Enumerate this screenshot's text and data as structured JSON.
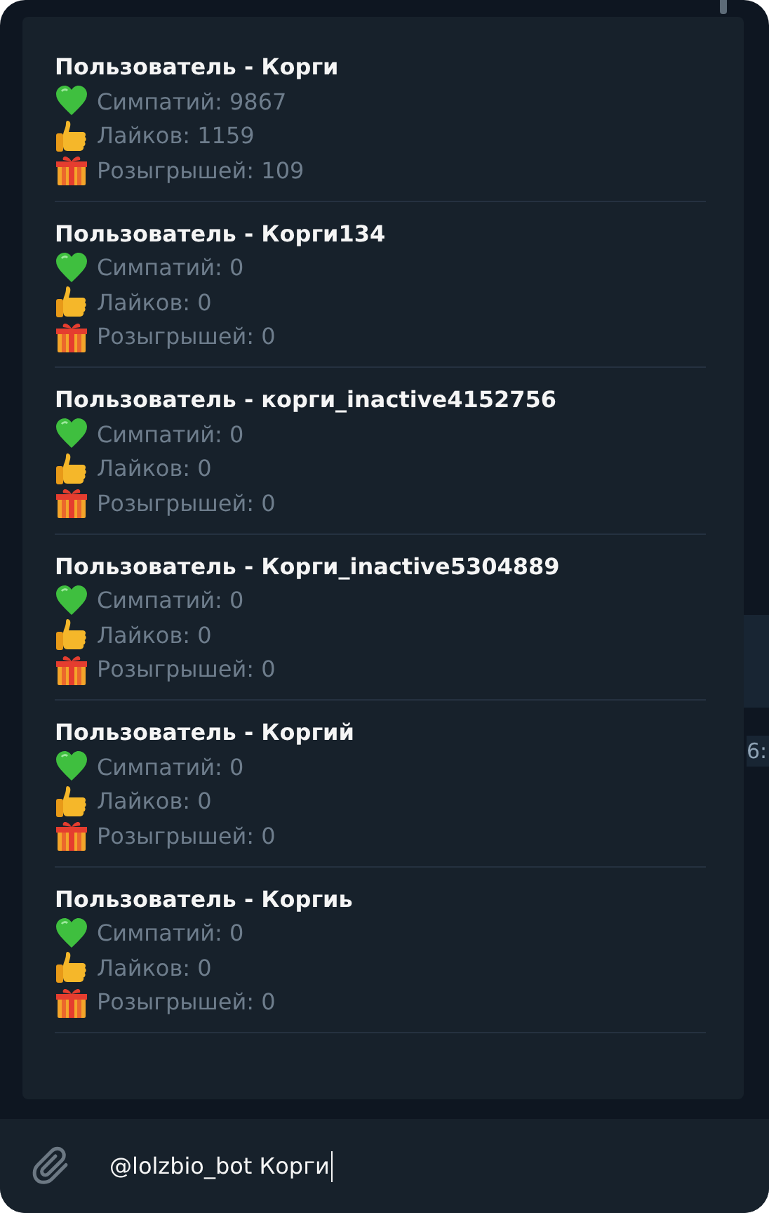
{
  "results": [
    {
      "title": "Пользователь - Корги",
      "stats": [
        {
          "kind": "heart",
          "text": "Симпатий: 9867"
        },
        {
          "kind": "like",
          "text": "Лайков: 1159"
        },
        {
          "kind": "gift",
          "text": "Розыгрышей: 109"
        }
      ]
    },
    {
      "title": "Пользователь - Корги134",
      "stats": [
        {
          "kind": "heart",
          "text": "Симпатий: 0"
        },
        {
          "kind": "like",
          "text": "Лайков: 0"
        },
        {
          "kind": "gift",
          "text": "Розыгрышей: 0"
        }
      ]
    },
    {
      "title": "Пользователь - корги_inactive4152756",
      "stats": [
        {
          "kind": "heart",
          "text": "Симпатий: 0"
        },
        {
          "kind": "like",
          "text": "Лайков: 0"
        },
        {
          "kind": "gift",
          "text": "Розыгрышей: 0"
        }
      ]
    },
    {
      "title": "Пользователь - Корги_inactive5304889",
      "stats": [
        {
          "kind": "heart",
          "text": "Симпатий: 0"
        },
        {
          "kind": "like",
          "text": "Лайков: 0"
        },
        {
          "kind": "gift",
          "text": "Розыгрышей: 0"
        }
      ]
    },
    {
      "title": "Пользователь - Коргий",
      "stats": [
        {
          "kind": "heart",
          "text": "Симпатий: 0"
        },
        {
          "kind": "like",
          "text": "Лайков: 0"
        },
        {
          "kind": "gift",
          "text": "Розыгрышей: 0"
        }
      ]
    },
    {
      "title": "Пользователь - Коргиь",
      "stats": [
        {
          "kind": "heart",
          "text": "Симпатий: 0"
        },
        {
          "kind": "like",
          "text": "Лайков: 0"
        },
        {
          "kind": "gift",
          "text": "Розыгрышей: 0"
        }
      ]
    }
  ],
  "background_message": {
    "time": "6:"
  },
  "composer": {
    "value": "@lolzbio_bot Корги"
  }
}
